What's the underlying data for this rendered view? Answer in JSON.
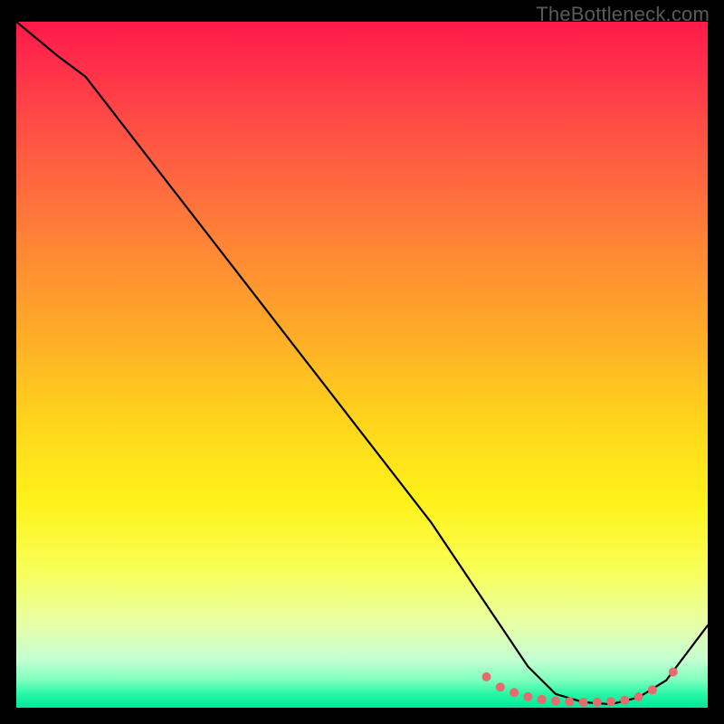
{
  "watermark": "TheBottleneck.com",
  "chart_data": {
    "type": "line",
    "title": "",
    "xlabel": "",
    "ylabel": "",
    "xlim": [
      0,
      100
    ],
    "ylim": [
      0,
      100
    ],
    "series": [
      {
        "name": "curve",
        "x": [
          0,
          6,
          10,
          20,
          30,
          40,
          50,
          60,
          68,
          74,
          78,
          82,
          86,
          90,
          94,
          100
        ],
        "y": [
          100,
          95,
          92,
          79,
          66,
          53,
          40,
          27,
          15,
          6,
          2,
          0.8,
          0.5,
          1.5,
          4,
          12
        ]
      }
    ],
    "markers": {
      "name": "dots",
      "x": [
        68,
        70,
        72,
        74,
        76,
        78,
        80,
        82,
        84,
        86,
        88,
        90,
        92,
        95
      ],
      "y": [
        4.5,
        3.0,
        2.2,
        1.6,
        1.2,
        1.0,
        0.9,
        0.8,
        0.8,
        0.9,
        1.1,
        1.6,
        2.6,
        5.2
      ]
    },
    "gradient_stops": [
      {
        "pos": 0.0,
        "color": "#ff1a4a"
      },
      {
        "pos": 0.5,
        "color": "#ffd41c"
      },
      {
        "pos": 0.8,
        "color": "#f8ff58"
      },
      {
        "pos": 1.0,
        "color": "#00e89a"
      }
    ]
  }
}
